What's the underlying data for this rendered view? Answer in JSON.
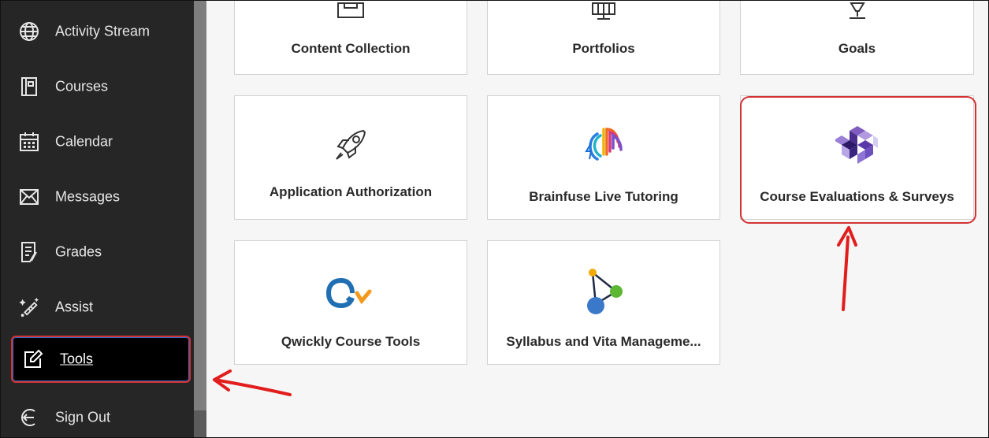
{
  "sidebar": {
    "items": [
      {
        "label": "Activity Stream",
        "icon": "globe-icon"
      },
      {
        "label": "Courses",
        "icon": "courses-icon"
      },
      {
        "label": "Calendar",
        "icon": "calendar-icon"
      },
      {
        "label": "Messages",
        "icon": "envelope-icon"
      },
      {
        "label": "Grades",
        "icon": "grades-icon"
      },
      {
        "label": "Assist",
        "icon": "assist-icon"
      },
      {
        "label": "Tools",
        "icon": "tools-edit-icon",
        "active": true
      },
      {
        "label": "Sign Out",
        "icon": "sign-out-icon"
      }
    ]
  },
  "tools": [
    {
      "name": "Content Collection",
      "icon": "content-collection-icon"
    },
    {
      "name": "Portfolios",
      "icon": "portfolios-icon"
    },
    {
      "name": "Goals",
      "icon": "goals-icon"
    },
    {
      "name": "Application Authorization",
      "icon": "rocket-icon"
    },
    {
      "name": "Brainfuse Live Tutoring",
      "icon": "brainfuse-logo-icon"
    },
    {
      "name": "Course Evaluations & Surveys",
      "icon": "course-evaluations-logo-icon"
    },
    {
      "name": "Qwickly Course Tools",
      "icon": "qwickly-logo-icon"
    },
    {
      "name": "Syllabus and Vita Manageme...",
      "icon": "syllabus-vita-logo-icon"
    }
  ],
  "colors": {
    "annotation": "#d23232",
    "sidebar_bg": "#262626",
    "page_bg": "#f6f6f6"
  }
}
